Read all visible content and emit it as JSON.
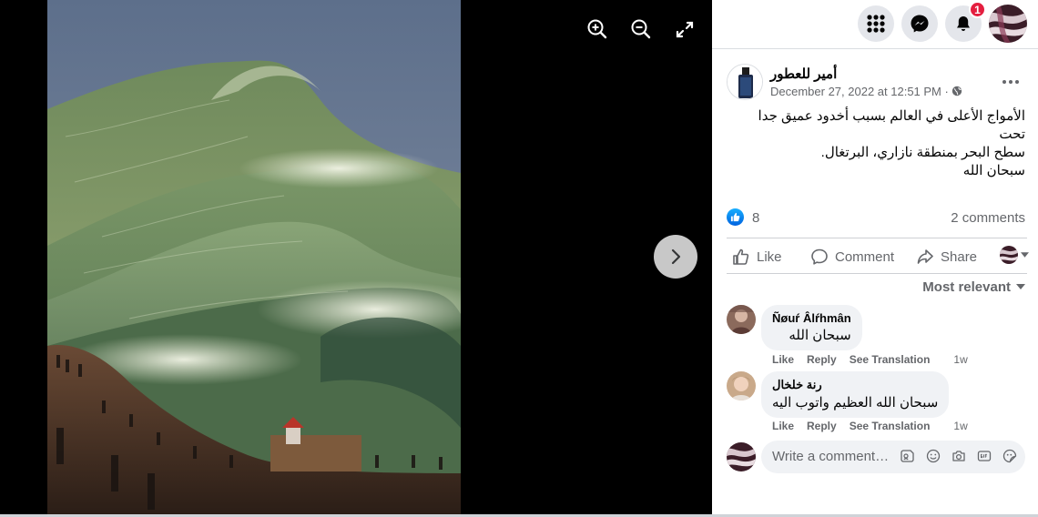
{
  "viewer": {
    "tools": [
      "zoom-in-icon",
      "zoom-out-icon",
      "fullscreen-icon"
    ],
    "next_icon": "chevron-right-icon"
  },
  "topbar": {
    "icons": [
      "menu-grid-icon",
      "messenger-icon",
      "bell-icon"
    ],
    "notification_count": "1"
  },
  "post": {
    "page_name": "أمير للعطور",
    "date": "December 27, 2022 at 12:51 PM",
    "separator": " · ",
    "audience_icon": "globe-icon",
    "text_line1": "الأمواج الأعلى في العالم بسبب أخدود عميق جدا تحت",
    "text_line2": "سطح البحر بمنطقة نازاري، البرتغال.",
    "text_2": "سبحان الله",
    "like_count": "8",
    "comment_count": "2 comments"
  },
  "actions": {
    "like": "Like",
    "comment": "Comment",
    "share": "Share"
  },
  "sort_label": "Most relevant",
  "comments": [
    {
      "name": "Ñøuŕ Âlŕhmân",
      "text": "سبحان الله",
      "like": "Like",
      "reply": "Reply",
      "translate": "See Translation",
      "time": "1w"
    },
    {
      "name": "رنة خلخال",
      "text": "سبحان الله العظيم واتوب اليه",
      "like": "Like",
      "reply": "Reply",
      "translate": "See Translation",
      "time": "1w"
    }
  ],
  "composer": {
    "placeholder": "Write a comment…",
    "icons": [
      "avatar-sticker-icon",
      "emoji-icon",
      "camera-icon",
      "gif-icon",
      "sticker-icon"
    ]
  },
  "colors": {
    "accent": "#1877f2",
    "secondary_text": "#65676b",
    "badge": "#e41e3f",
    "bubble": "#f0f2f5"
  }
}
